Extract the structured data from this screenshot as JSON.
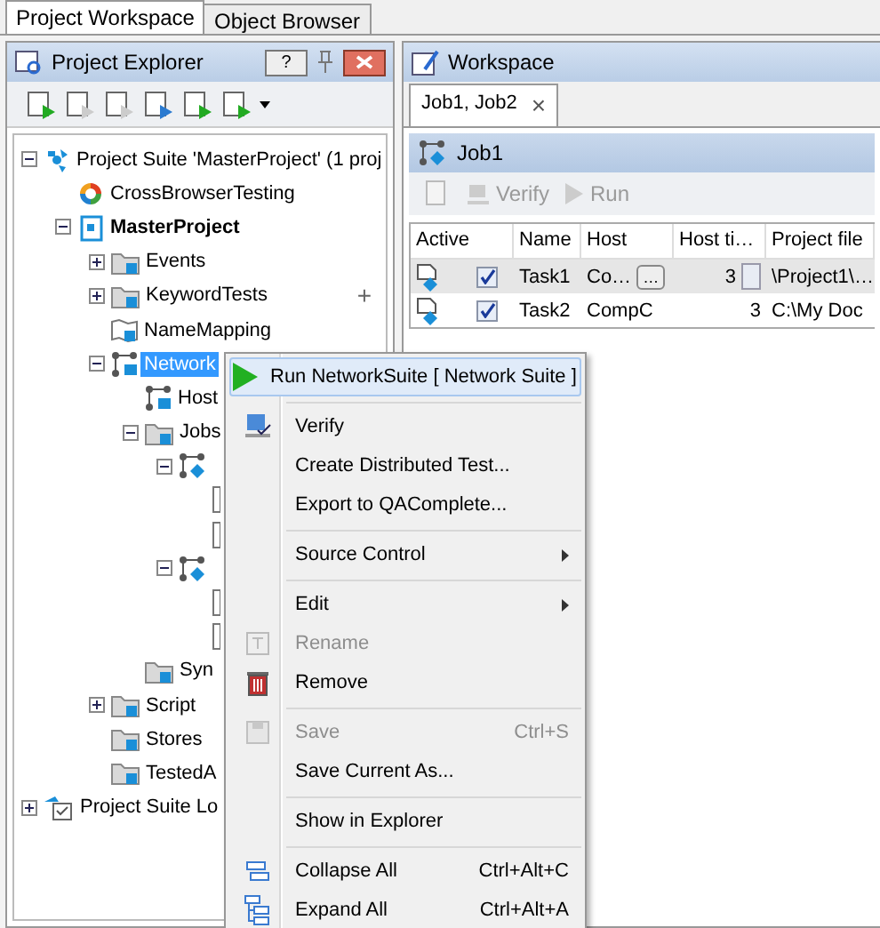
{
  "tabs": [
    {
      "label": "Project Workspace",
      "selected": true
    },
    {
      "label": "Object Browser",
      "selected": false
    }
  ],
  "explorer": {
    "title": "Project Explorer",
    "help": "?",
    "tree": [
      {
        "label": "Project Suite 'MasterProject' (1 proj",
        "kind": "suite",
        "expanded": true,
        "selected": false,
        "children": [
          {
            "label": "CrossBrowserTesting",
            "kind": "ring",
            "selected": false
          },
          {
            "label": "MasterProject",
            "kind": "project",
            "bold": true,
            "expanded": true,
            "selected": false,
            "children": [
              {
                "label": "Events",
                "kind": "folder",
                "expanded": false,
                "selected": false
              },
              {
                "label": "KeywordTests",
                "kind": "folder",
                "expanded": false,
                "selected": false,
                "add": "+"
              },
              {
                "label": "NameMapping",
                "kind": "map",
                "selected": false
              },
              {
                "label": "Network",
                "kind": "network",
                "expanded": true,
                "selected": true,
                "children": [
                  {
                    "label": "Host",
                    "kind": "network",
                    "selected": false
                  },
                  {
                    "label": "Jobs",
                    "kind": "folder",
                    "expanded": true,
                    "selected": false,
                    "children": [
                      {
                        "kind": "job",
                        "expanded": true,
                        "selected": false,
                        "children": [
                          {
                            "kind": "task",
                            "selected": false
                          },
                          {
                            "kind": "task",
                            "selected": false
                          }
                        ]
                      },
                      {
                        "kind": "job",
                        "expanded": true,
                        "selected": false,
                        "children": [
                          {
                            "kind": "task",
                            "selected": false
                          },
                          {
                            "kind": "task",
                            "selected": false
                          }
                        ]
                      }
                    ]
                  },
                  {
                    "label": "Syn",
                    "kind": "folder",
                    "selected": false
                  }
                ]
              },
              {
                "label": "Script",
                "kind": "folder",
                "expanded": false,
                "selected": false
              },
              {
                "label": "Stores",
                "kind": "folder",
                "selected": false
              },
              {
                "label": "TestedA",
                "kind": "folder",
                "selected": false
              }
            ]
          }
        ]
      },
      {
        "label": "Project Suite Lo",
        "kind": "log",
        "expanded": false,
        "selected": false
      }
    ]
  },
  "workspace": {
    "title": "Workspace",
    "tabs": [
      {
        "label": "Job1, Job2",
        "close": "×",
        "selected": true
      }
    ],
    "job": {
      "title": "Job1",
      "toolbar": [
        {
          "label": "Verify",
          "disabled": true
        },
        {
          "label": "Run",
          "disabled": true
        }
      ],
      "columns": [
        "Active",
        "Name",
        "Host",
        "Host ti…",
        "Project file"
      ],
      "rows": [
        {
          "active": true,
          "name": "Task1",
          "host": "Co…",
          "browse": "…",
          "timeout": "3",
          "file": "\\Project1\\…",
          "selected": true
        },
        {
          "active": true,
          "name": "Task2",
          "host": "CompC",
          "timeout": "3",
          "file": "C:\\My Doc",
          "selected": false
        }
      ]
    }
  },
  "context_menu": [
    {
      "kind": "run",
      "label": "Run NetworkSuite  [ Network Suite ]",
      "selected": true,
      "disabled": false
    },
    {
      "kind": "separator"
    },
    {
      "kind": "verify",
      "label": "Verify",
      "selected": false,
      "disabled": false
    },
    {
      "kind": "plain",
      "label": "Create Distributed Test...",
      "selected": false,
      "disabled": false
    },
    {
      "kind": "plain",
      "label": "Export to QAComplete...",
      "selected": false,
      "disabled": false
    },
    {
      "kind": "separator"
    },
    {
      "kind": "submenu",
      "label": "Source Control",
      "selected": false,
      "disabled": false
    },
    {
      "kind": "separator"
    },
    {
      "kind": "submenu",
      "label": "Edit",
      "selected": false,
      "disabled": false
    },
    {
      "kind": "rename",
      "label": "Rename",
      "selected": false,
      "disabled": true
    },
    {
      "kind": "remove",
      "label": "Remove",
      "selected": false,
      "disabled": false
    },
    {
      "kind": "separator"
    },
    {
      "kind": "save",
      "label": "Save",
      "shortcut": "Ctrl+S",
      "selected": false,
      "disabled": true
    },
    {
      "kind": "plain",
      "label": "Save Current As...",
      "selected": false,
      "disabled": false
    },
    {
      "kind": "separator"
    },
    {
      "kind": "plain",
      "label": "Show in Explorer",
      "selected": false,
      "disabled": false
    },
    {
      "kind": "separator"
    },
    {
      "kind": "collapse",
      "label": "Collapse All",
      "shortcut": "Ctrl+Alt+C",
      "selected": false,
      "disabled": false
    },
    {
      "kind": "expand",
      "label": "Expand All",
      "shortcut": "Ctrl+Alt+A",
      "selected": false,
      "disabled": false
    }
  ]
}
